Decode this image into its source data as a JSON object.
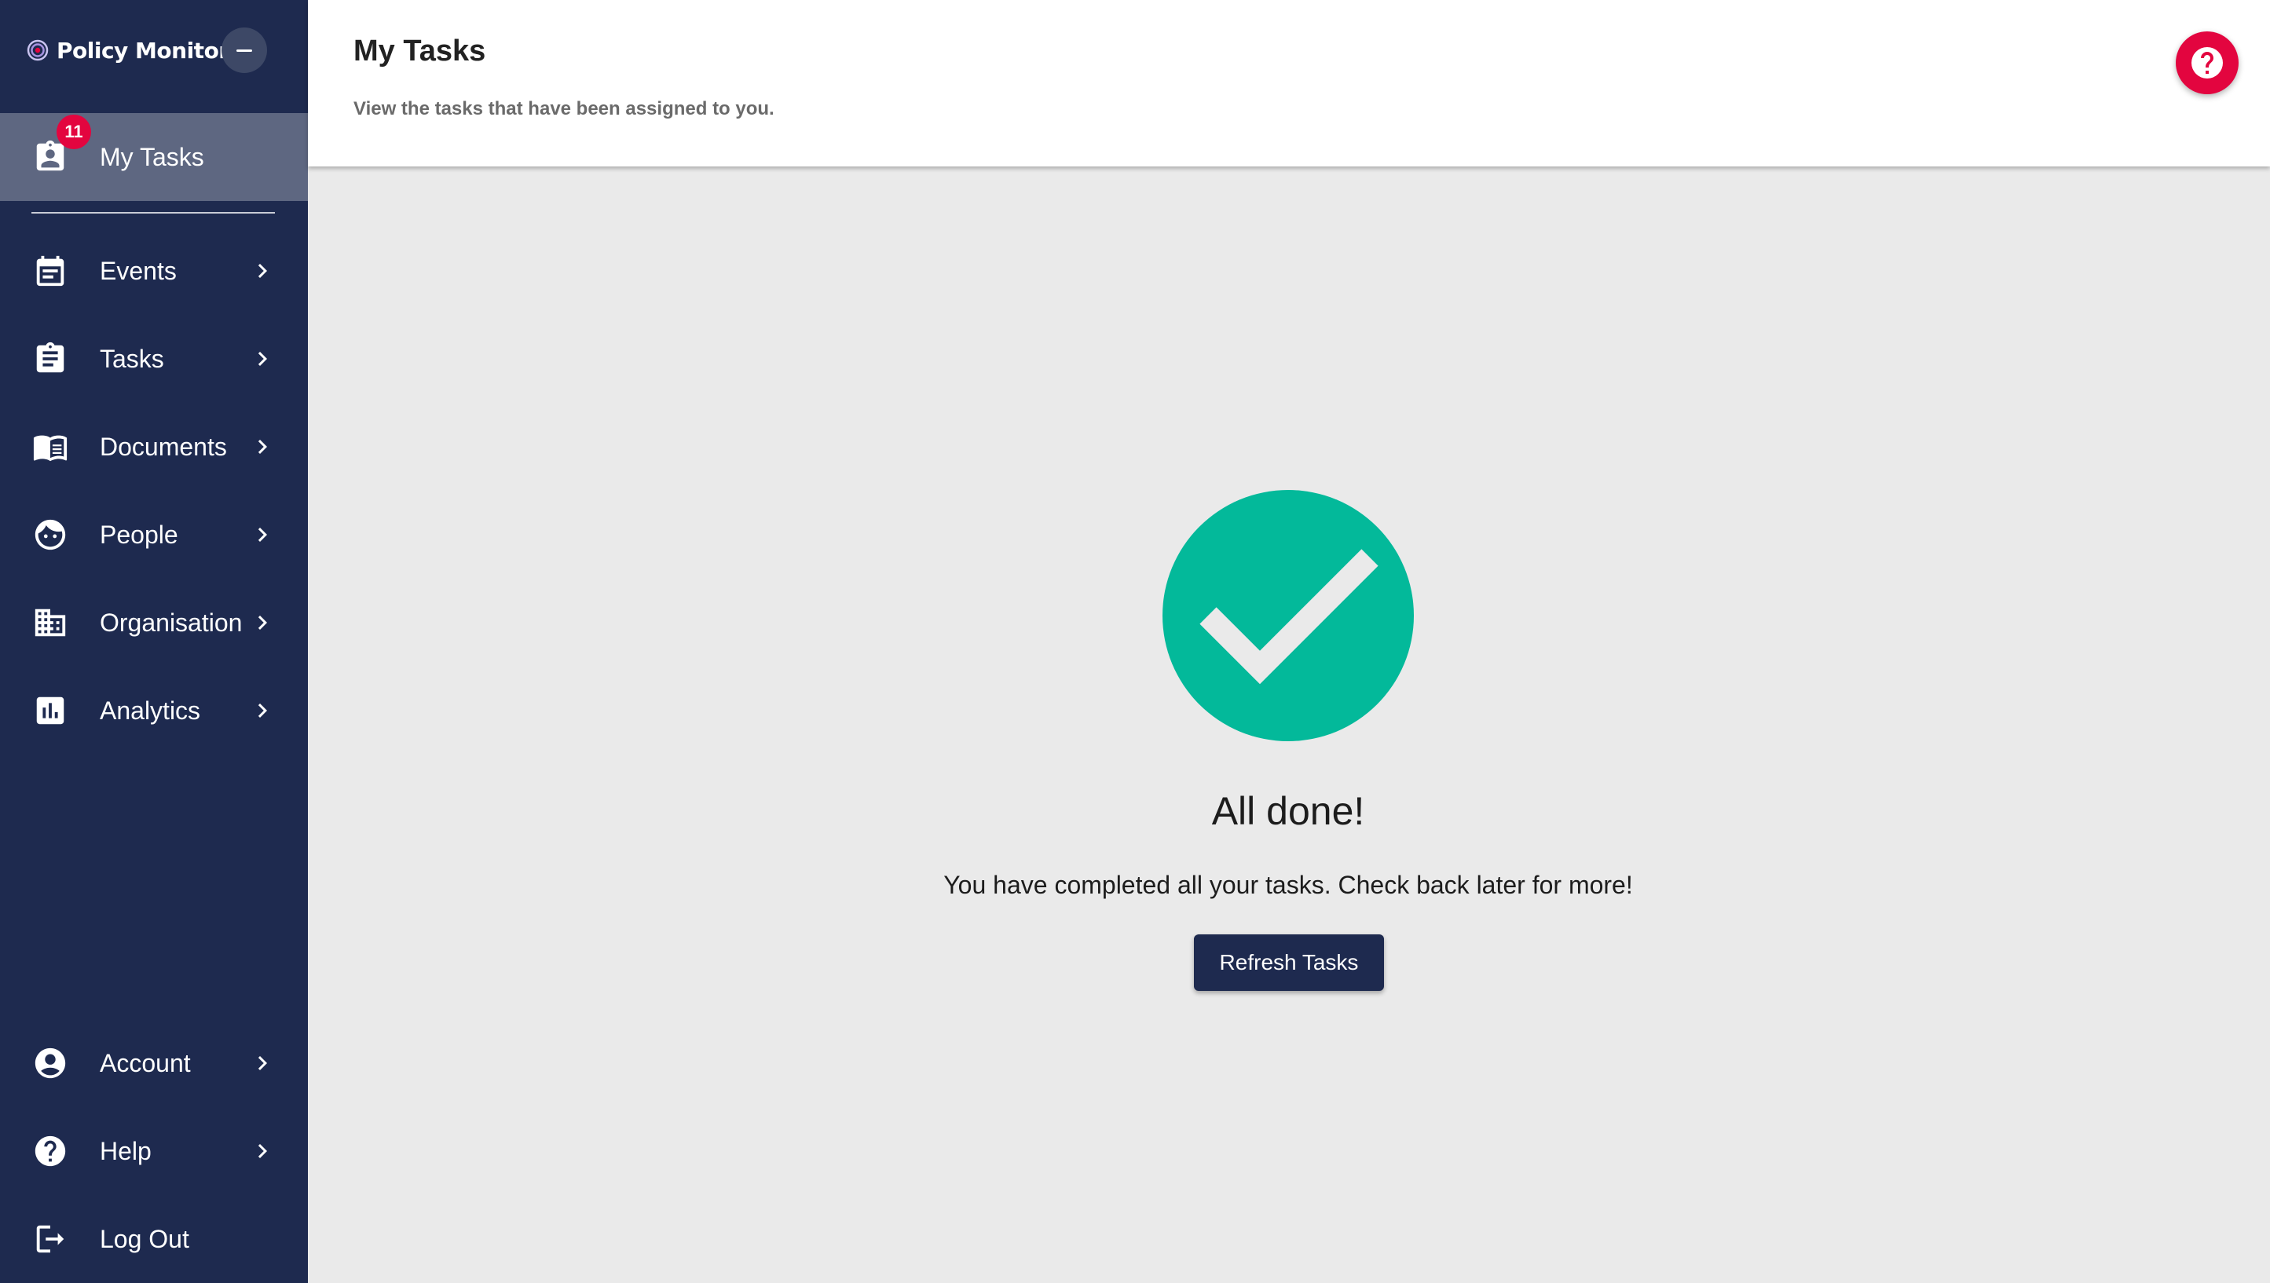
{
  "app": {
    "name": "Policy Monitor",
    "logo_icon": "target-logo-icon",
    "collapse_icon": "minus-icon"
  },
  "colors": {
    "sidebar_bg": "#1e2a4f",
    "active_item_bg": "#5e6781",
    "accent": "#e3053f",
    "success": "#03b99a",
    "content_bg": "#eaeaea"
  },
  "sidebar": {
    "active": {
      "label": "My Tasks",
      "icon": "assigned-task-icon",
      "badge_count": "11"
    },
    "items": [
      {
        "label": "Events",
        "icon": "calendar-icon"
      },
      {
        "label": "Tasks",
        "icon": "clipboard-icon"
      },
      {
        "label": "Documents",
        "icon": "book-icon"
      },
      {
        "label": "People",
        "icon": "face-icon"
      },
      {
        "label": "Organisation",
        "icon": "building-icon"
      },
      {
        "label": "Analytics",
        "icon": "chart-icon"
      }
    ],
    "bottom_items": [
      {
        "label": "Account",
        "icon": "account-circle-icon"
      },
      {
        "label": "Help",
        "icon": "help-circle-icon"
      },
      {
        "label": "Log Out",
        "icon": "logout-icon"
      }
    ]
  },
  "header": {
    "title": "My Tasks",
    "subtitle": "View the tasks that have been assigned to you.",
    "help_icon": "help-icon"
  },
  "main": {
    "status_icon": "check-circle-icon",
    "title": "All done!",
    "message": "You have completed all your tasks. Check back later for more!",
    "refresh_label": "Refresh Tasks"
  }
}
